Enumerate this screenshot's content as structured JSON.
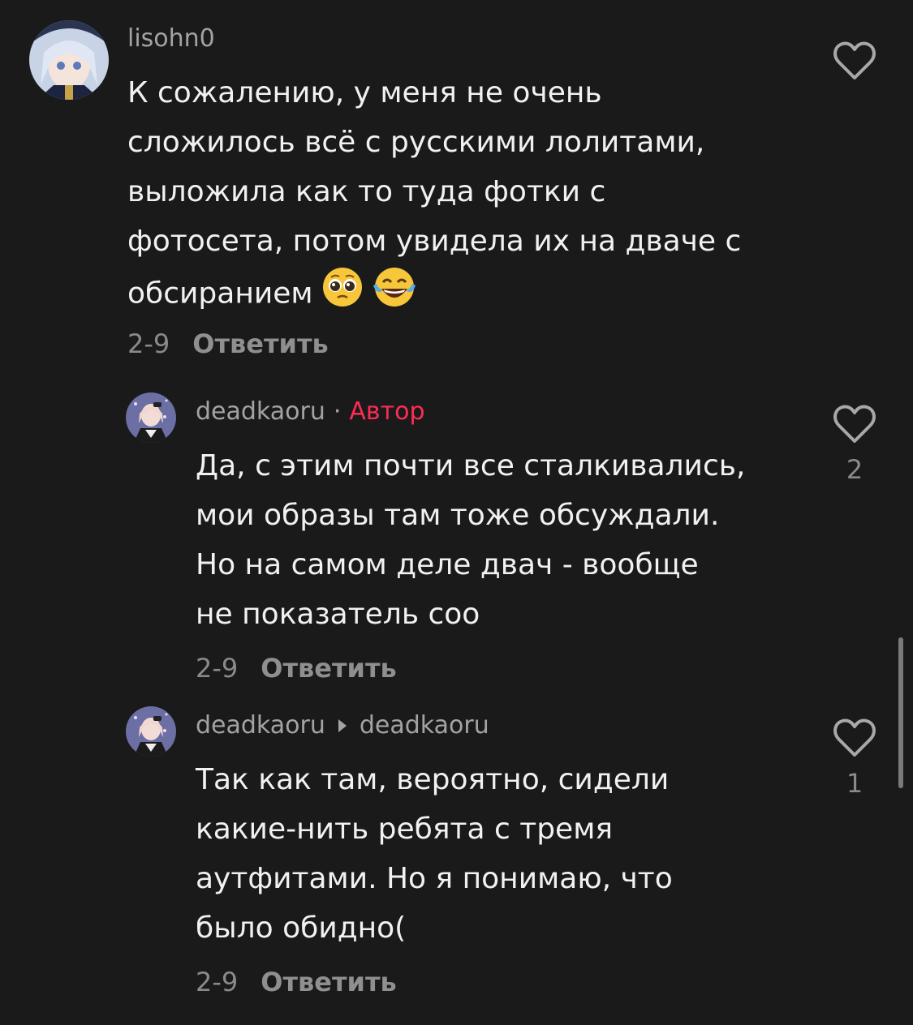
{
  "comments": [
    {
      "username": "lisohn0",
      "text": "К сожалению, у меня не очень\nсложилось всё с русскими лолитами,\nвыложила как то туда фотки с\nфотосета, потом увидела их на дваче с\nобсиранием",
      "emoji": [
        "pleading-face",
        "face-with-tears-of-joy"
      ],
      "date": "2-9",
      "reply_label": "Ответить",
      "like_count": ""
    },
    {
      "username": "deadkaoru",
      "separator": "·",
      "author_badge": "Автор",
      "text": "Да, с этим почти все сталкивались,\nмои образы там тоже обсуждали.\nНо на самом деле двач - вообще\nне показатель соо",
      "date": "2-9",
      "reply_label": "Ответить",
      "like_count": "2"
    },
    {
      "username": "deadkaoru",
      "reply_to": "deadkaoru",
      "text": "Так как там, вероятно, сидели\nкакие-нить ребята с тремя\nаутфитами. Но я понимаю, что\nбыло обидно(",
      "date": "2-9",
      "reply_label": "Ответить",
      "like_count": "1"
    }
  ],
  "colors": {
    "background": "#1a1a1a",
    "author_badge": "#fe2c55",
    "secondary_text": "#a3a3a3"
  }
}
